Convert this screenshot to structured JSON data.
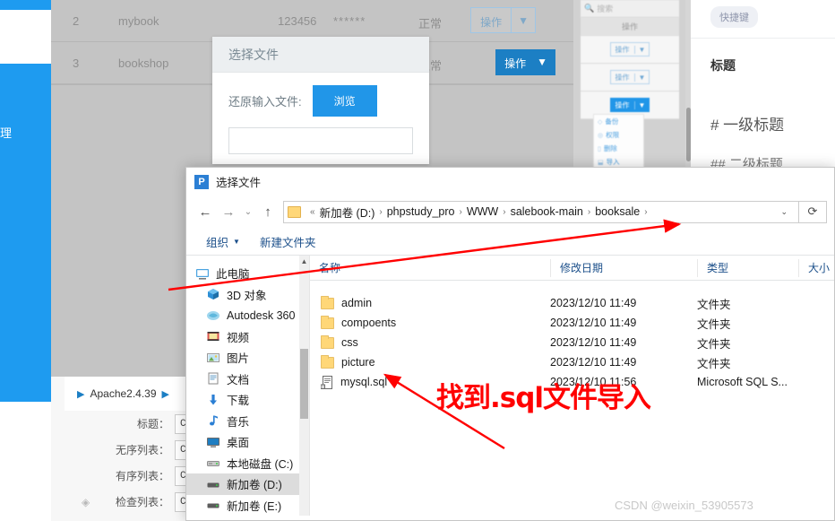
{
  "background": {
    "sidebar_label": "理",
    "table_rows": [
      {
        "id": "2",
        "name": "mybook",
        "user": "123456",
        "password": "******",
        "status": "正常",
        "action": "操作",
        "carat": "▼",
        "style": "outline"
      },
      {
        "id": "3",
        "name": "bookshop",
        "user": "",
        "password": "",
        "status": "正常",
        "action": "操作",
        "carat": "▼",
        "style": "solid"
      }
    ],
    "app_modal": {
      "title": "选择文件",
      "field_label": "还原输入文件:",
      "browse_label": "浏览",
      "input_value": ""
    },
    "mini_panel": {
      "search_placeholder": "搜索",
      "column_header": "操作",
      "buttons": [
        {
          "label": "操作",
          "carat": "▼",
          "style": "outline"
        },
        {
          "label": "操作",
          "carat": "▼",
          "style": "outline"
        },
        {
          "label": "操作",
          "carat": "▼",
          "style": "solid"
        }
      ],
      "dropdown_items": [
        {
          "icon": "backup-icon",
          "label": "备份"
        },
        {
          "icon": "permission-icon",
          "label": "权限"
        },
        {
          "icon": "delete-icon",
          "label": "删除"
        },
        {
          "icon": "import-icon",
          "label": "导入"
        }
      ]
    },
    "markdown_panel": {
      "tag": "快捷键",
      "heading_label": "标题",
      "h1_sample": "# 一级标题",
      "h2_sample": "## 二级标题"
    },
    "phpstudy": {
      "play_icon": "play-icon",
      "service": "Apache2.4.39",
      "next_icon": "play-icon"
    },
    "shortcuts": [
      {
        "label": "标题：",
        "value": "Ctrl/Command"
      },
      {
        "label": "无序列表：",
        "value": "Ctrl/Co"
      },
      {
        "label": "有序列表：",
        "value": "Ctrl/Co"
      },
      {
        "label": "检查列表：",
        "value": "Ctrl/Co"
      }
    ]
  },
  "file_dialog": {
    "title": "选择文件",
    "title_icon_letter": "P",
    "nav": {
      "back_icon": "arrow-left-icon",
      "forward_icon": "arrow-right-icon",
      "recent_icon": "chevron-down-icon",
      "up_icon": "arrow-up-icon",
      "refresh_icon": "refresh-icon",
      "dropdown_icon": "chevron-down-icon"
    },
    "breadcrumb": {
      "prefix": "«",
      "separator": "›",
      "items": [
        "新加卷 (D:)",
        "phpstudy_pro",
        "WWW",
        "salebook-main",
        "booksale"
      ]
    },
    "toolbar": [
      {
        "label": "组织",
        "carat": "▼"
      },
      {
        "label": "新建文件夹",
        "carat": ""
      }
    ],
    "tree": {
      "scroll_up_icon": "chevron-up-icon",
      "items": [
        {
          "label": "此电脑",
          "icon": "pc-icon",
          "selected": false,
          "root": true
        },
        {
          "label": "3D 对象",
          "icon": "3d-object-icon",
          "selected": false,
          "root": false
        },
        {
          "label": "Autodesk 360",
          "icon": "autodesk-icon",
          "selected": false,
          "root": false
        },
        {
          "label": "视频",
          "icon": "video-icon",
          "selected": false,
          "root": false
        },
        {
          "label": "图片",
          "icon": "pictures-icon",
          "selected": false,
          "root": false
        },
        {
          "label": "文档",
          "icon": "documents-icon",
          "selected": false,
          "root": false
        },
        {
          "label": "下载",
          "icon": "downloads-icon",
          "selected": false,
          "root": false
        },
        {
          "label": "音乐",
          "icon": "music-icon",
          "selected": false,
          "root": false
        },
        {
          "label": "桌面",
          "icon": "desktop-icon",
          "selected": false,
          "root": false
        },
        {
          "label": "本地磁盘 (C:)",
          "icon": "drive-icon",
          "selected": false,
          "root": false
        },
        {
          "label": "新加卷 (D:)",
          "icon": "drive-icon",
          "selected": true,
          "root": false
        },
        {
          "label": "新加卷 (E:)",
          "icon": "drive-icon",
          "selected": false,
          "root": false
        }
      ]
    },
    "file_list": {
      "columns": [
        "名称",
        "修改日期",
        "类型",
        "大小"
      ],
      "sort_indicator_icon": "chevron-up-icon",
      "rows": [
        {
          "name": "admin",
          "icon": "folder-icon",
          "date": "2023/12/10 11:49",
          "type": "文件夹",
          "size": ""
        },
        {
          "name": "compoents",
          "icon": "folder-icon",
          "date": "2023/12/10 11:49",
          "type": "文件夹",
          "size": ""
        },
        {
          "name": "css",
          "icon": "folder-icon",
          "date": "2023/12/10 11:49",
          "type": "文件夹",
          "size": ""
        },
        {
          "name": "picture",
          "icon": "folder-icon",
          "date": "2023/12/10 11:49",
          "type": "文件夹",
          "size": ""
        },
        {
          "name": "mysql.sql",
          "icon": "sql-file-icon",
          "date": "2023/12/10 11:56",
          "type": "Microsoft SQL S...",
          "size": ""
        }
      ]
    }
  },
  "annotations": {
    "callout_text": "找到.sql文件导入",
    "callout_color": "#ff0000",
    "arrow_count": 2
  },
  "watermark": "CSDN @weixin_53905573"
}
